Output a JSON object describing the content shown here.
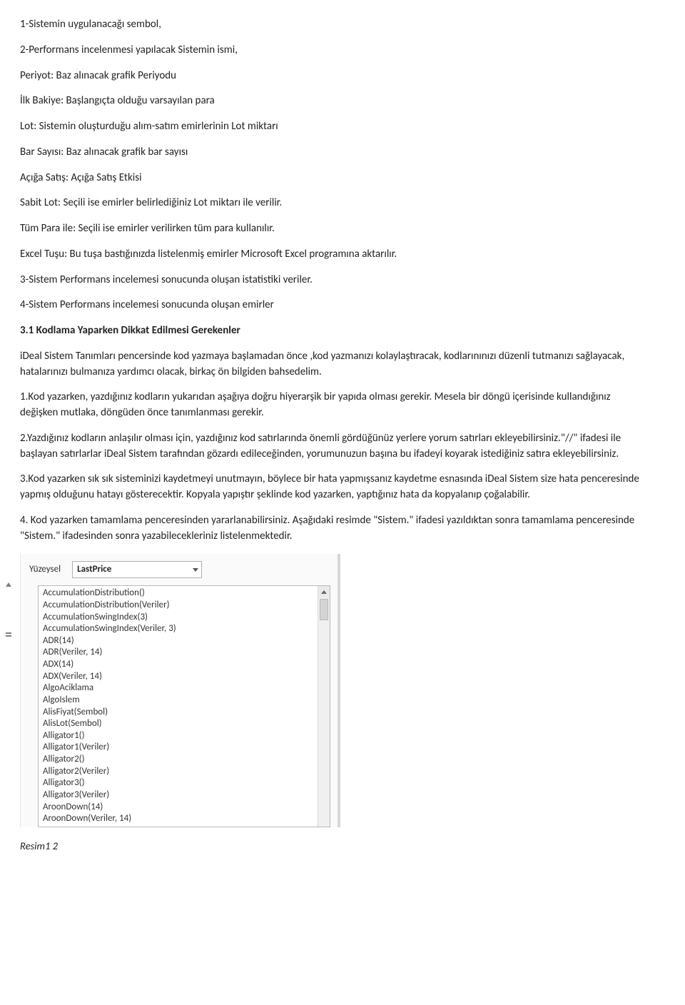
{
  "paragraphs": {
    "p1": "1-Sistemin uygulanacağı sembol,",
    "p2": "2-Performans incelenmesi yapılacak Sistemin ismi,",
    "p3": "Periyot: Baz alınacak grafik Periyodu",
    "p4": "İlk Bakiye: Başlangıçta olduğu varsayılan para",
    "p5": "Lot: Sistemin oluşturduğu alım-satım emirlerinin Lot miktarı",
    "p6": "Bar Sayısı: Baz alınacak grafik bar sayısı",
    "p7": "Açığa Satış: Açığa Satış Etkisi",
    "p8": "Sabit Lot: Seçili ise emirler belirlediğiniz Lot miktarı ile verilir.",
    "p9": "Tüm Para ile: Seçili ise emirler verilirken tüm para kullanılır.",
    "p10": "Excel Tuşu: Bu tuşa bastığınızda listelenmiş emirler Microsoft Excel programına aktarılır.",
    "p11": "3-Sistem Performans incelemesi sonucunda oluşan istatistiki veriler.",
    "p12": "4-Sistem Performans incelemesi sonucunda oluşan emirler",
    "h31": "3.1 Kodlama Yaparken Dikkat Edilmesi Gerekenler",
    "p13": "iDeal Sistem Tanımları pencersinde kod yazmaya başlamadan önce ,kod yazmanızı kolaylaştıracak, kodlarınınızı düzenli tutmanızı sağlayacak, hatalarınızı bulmanıza yardımcı olacak, birkaç ön bilgiden bahsedelim.",
    "p14": "1.Kod yazarken, yazdığınız kodların yukarıdan aşağıya doğru hiyerarşik bir yapıda olması gerekir. Mesela bir döngü içerisinde kullandığınız değişken mutlaka, döngüden önce tanımlanması gerekir.",
    "p15": "2.Yazdığınız kodların anlaşılır olması için, yazdığınız kod satırlarında önemli gördüğünüz yerlere yorum satırları ekleyebilirsiniz.\"//\" ifadesi ile başlayan satırlarlar iDeal Sistem tarafından gözardı edileceğinden, yorumunuzun başına bu ifadeyi koyarak istediğiniz satıra ekleyebilirsiniz.",
    "p16": "3.Kod yazarken sık sık sisteminizi kaydetmeyi unutmayın, böylece bir hata yapmışsanız kaydetme esnasında iDeal Sistem size hata penceresinde yapmış olduğunu hatayı gösterecektir. Kopyala yapıştır şeklinde kod yazarken, yaptığınız hata da kopyalanıp çoğalabilir.",
    "p17": "4. Kod yazarken tamamlama penceresinden yararlanabilirsiniz. Aşağıdaki resimde \"Sistem.\" ifadesi yazıldıktan sonra tamamlama penceresinde \"Sistem.\" ifadesinden sonra yazabilecekleriniz listelenmektedir."
  },
  "ui": {
    "label": "Yüzeysel",
    "select_value": "LastPrice",
    "items": [
      "AccumulationDistribution()",
      "AccumulationDistribution(Veriler)",
      "AccumulationSwingIndex(3)",
      "AccumulationSwingIndex(Veriler, 3)",
      "ADR(14)",
      "ADR(Veriler, 14)",
      "ADX(14)",
      "ADX(Veriler, 14)",
      "AlgoAciklama",
      "AlgoIslem",
      "AlisFiyat(Sembol)",
      "AlisLot(Sembol)",
      "Alligator1()",
      "Alligator1(Veriler)",
      "Alligator2()",
      "Alligator2(Veriler)",
      "Alligator3()",
      "Alligator3(Veriler)",
      "AroonDown(14)",
      "AroonDown(Veriler, 14)"
    ]
  },
  "caption": "Resim1 2"
}
